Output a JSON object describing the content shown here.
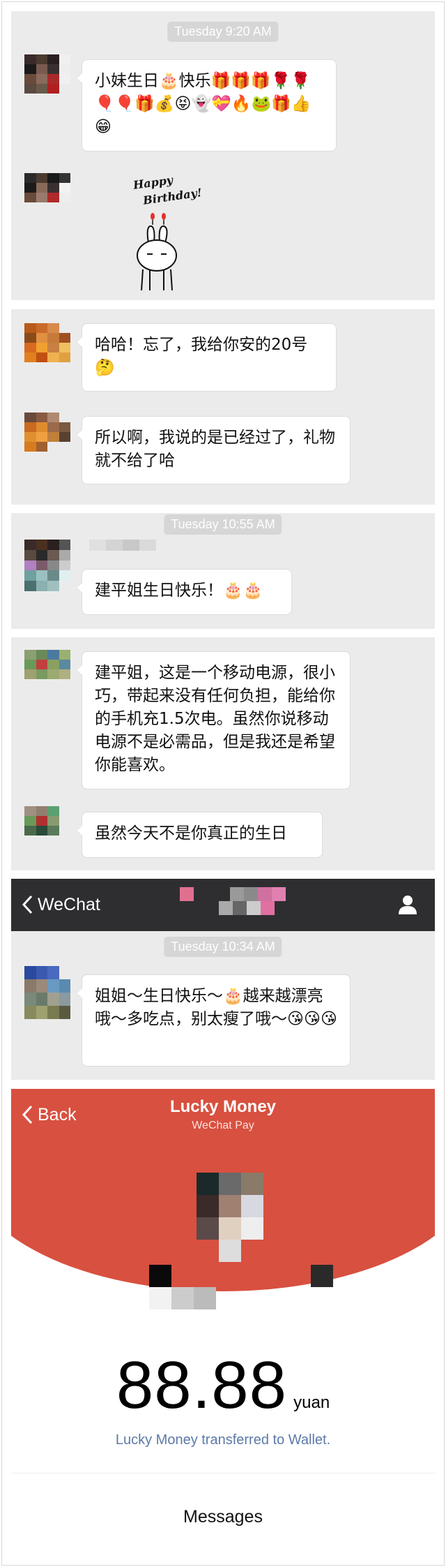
{
  "chat1": {
    "timestamp": "Tuesday 9:20 AM",
    "message": "小妹生日🎂快乐🎁🎁🎁🌹🌹🎈🎈🎁💰😝👻💝🔥🐸🎁👍😁",
    "sticker_line1": "Happy",
    "sticker_line2": "Birthday!"
  },
  "chat2": {
    "message1": "哈哈！忘了，我给你安的20号🤔",
    "message2": "所以啊，我说的是已经过了，礼物就不给了哈"
  },
  "chat3": {
    "timestamp": "Tuesday 10:55 AM",
    "message": "建平姐生日快乐！🎂🎂"
  },
  "chat4": {
    "message1": "建平姐，这是一个移动电源，很小巧，带起来没有任何负担，能给你的手机充1.5次电。虽然你说移动电源不是必需品，但是我还是希望你能喜欢。",
    "message2": "虽然今天不是你真正的生日"
  },
  "chat5": {
    "back_label": "WeChat",
    "timestamp": "Tuesday 10:34 AM",
    "message": "姐姐～生日快乐～🎂越来越漂亮哦～多吃点，别太瘦了哦～😘😘😘"
  },
  "lucky_money": {
    "back_label": "Back",
    "title": "Lucky Money",
    "subtitle": "WeChat Pay",
    "amount": "88.88",
    "unit": "yuan",
    "note": "Lucky Money transferred to Wallet.",
    "messages_link": "Messages"
  },
  "colors": {
    "chat_bg": "#ebebeb",
    "red": "#d8503f",
    "link": "#5b7aa8",
    "nav_dark": "#2e2e31"
  },
  "icons": [
    "chevron-left-icon",
    "user-icon",
    "birthday-bunny-sticker"
  ]
}
